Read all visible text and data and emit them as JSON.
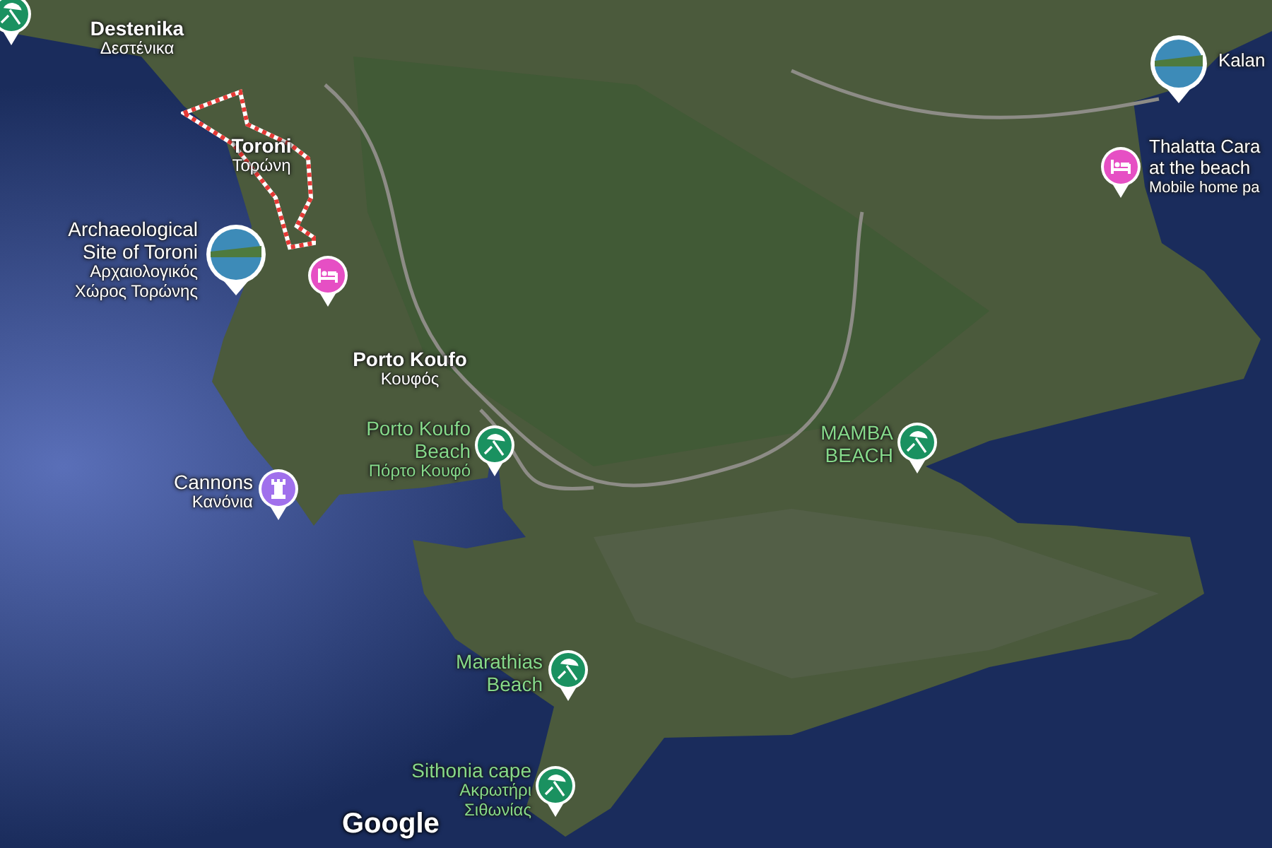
{
  "map": {
    "places": [
      {
        "kind": "town",
        "name": "Destenika",
        "local_name": "Δεστένικα"
      },
      {
        "kind": "town",
        "name": "Toroni",
        "local_name": "Τορώνη"
      },
      {
        "kind": "photo",
        "name": "Archaeological Site of Toroni",
        "local_name": "Αρχαιολογικός Χώρος Τορώνης"
      },
      {
        "kind": "hotel"
      },
      {
        "kind": "town",
        "name": "Porto Koufo",
        "local_name": "Κουφός"
      },
      {
        "kind": "beach",
        "name": "Porto Koufo Beach",
        "local_name": "Πόρτο Κουφό"
      },
      {
        "kind": "landmark",
        "name": "Cannons",
        "local_name": "Κανόνια"
      },
      {
        "kind": "beach",
        "name": "MAMBA BEACH"
      },
      {
        "kind": "beach",
        "name": "Marathias Beach"
      },
      {
        "kind": "beach",
        "name": "Sithonia cape",
        "local_name": "Ακρωτήρι Σιθωνίας"
      },
      {
        "kind": "photo",
        "name": "Kalan"
      },
      {
        "kind": "hotel",
        "name": "Thalatta Cara at the beach",
        "category": "Mobile home pa"
      },
      {
        "kind": "beach"
      }
    ],
    "attribution": "Google"
  }
}
